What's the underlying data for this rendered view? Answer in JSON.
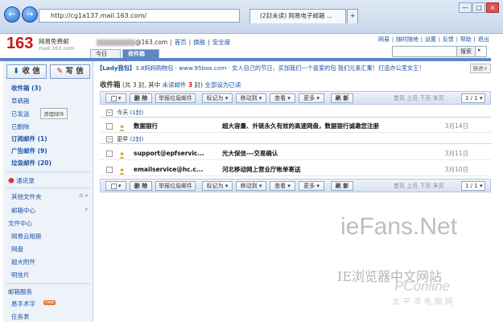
{
  "browser": {
    "back": "←",
    "forward": "→",
    "address": "http://cg1a137.mail.163.com/",
    "tab1": "(2封未读) 网易电子邮箱 ...",
    "tab_close": "×",
    "min": "—",
    "max": "□",
    "close": "×"
  },
  "header": {
    "logo": "163",
    "logo_line1": "网易免费邮",
    "logo_line2": "mail.163.com",
    "user_suffix": "@163.com",
    "user_links": [
      "首页",
      "换肤",
      "安全度"
    ],
    "top_links": "网易 ∣ 随时随地  ∣ 设置 ∣ 反馈 ∣ 帮助 ∣ 退出",
    "search_button": "搜索",
    "search_help": "▸",
    "tabs": [
      "今日",
      "收件箱"
    ]
  },
  "sidebar": {
    "receive": "收 信",
    "write": "写 信",
    "items": [
      {
        "label": "收件箱 (3)",
        "bold": true
      },
      {
        "label": "草稿箱"
      },
      {
        "label": "已发送"
      },
      {
        "label": "已删除"
      },
      {
        "label": "订阅邮件 (1)",
        "bold": true
      },
      {
        "label": "广告邮件 (9)",
        "bold": true
      },
      {
        "label": "垃圾邮件 (20)",
        "bold": true
      }
    ],
    "folder_action": "清理邮件",
    "sections": [
      "通讯录",
      "其他文件夹",
      "邮箱中心",
      "文件中心",
      "网易云相册",
      "网盘",
      "超大附件",
      "明信片",
      "邮箱服务",
      "易手术字",
      "任务表"
    ]
  },
  "main": {
    "ad_lady": "【Lady我包】",
    "ad_text": "3.8妈妈购物包 · www.95box.com · 女人自己的节日，买加我们一个喜爱的包  我们元素汇集！打造办公室女王！",
    "ad_close": "随进×",
    "inbox_title": "收件箱",
    "inbox_counts": "(共 3 封, 其中",
    "unread_label": "未读邮件",
    "unread_count": "3",
    "inbox_tail": "封",
    "mark_all": "全部设为已读",
    "toolbar": {
      "select": "▾",
      "delete": "删 除",
      "report": "举报垃圾邮件",
      "mark": "标记为 ▾",
      "move": "移动到 ▾",
      "view": "查看 ▾",
      "more": "更多 ▾",
      "refresh": "刷 新",
      "pager": "首页  上页  下页  末页",
      "page": "1 / 1 ▾"
    },
    "groups": [
      {
        "name": "今天",
        "link": "(1封)",
        "mails": [
          {
            "sender": "数据银行",
            "subject": "超大容量、外链永久有效的高速网盘，数据银行诚邀您注册",
            "date": "3月14日"
          }
        ]
      },
      {
        "name": "更早",
        "link": "(2封)",
        "mails": [
          {
            "sender": "support@epfservic...",
            "subject": "光大保信---交易确认",
            "date": "3月11日"
          },
          {
            "sender": "emailservice@hc.c...",
            "subject": "河北移动网上营业厅帐单寄送",
            "date": "3月10日"
          }
        ]
      }
    ]
  },
  "watermark": {
    "line1": "ieFans.Net",
    "line2": "IE浏览器中文网站",
    "line3": "PConline",
    "line4": "太 平 洋 电 脑 网"
  }
}
